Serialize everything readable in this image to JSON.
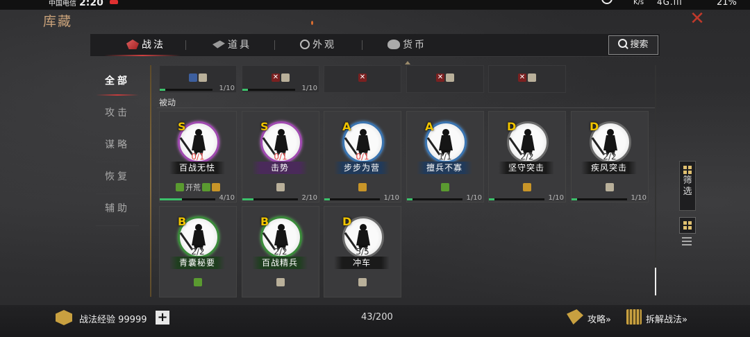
{
  "status_bar": {
    "carrier": "中国电信",
    "time": "2:20",
    "net_speed": "K/s",
    "signal": "4G.ıll",
    "battery": "21%"
  },
  "page_title": "库藏",
  "tabs": [
    {
      "label": "战法",
      "icon": "scroll-icon",
      "active": true
    },
    {
      "label": "道具",
      "icon": "item-icon",
      "active": false
    },
    {
      "label": "外观",
      "icon": "refresh-icon",
      "active": false
    },
    {
      "label": "货币",
      "icon": "coin-bag-icon",
      "active": false
    }
  ],
  "search_label": "搜索",
  "left_nav": [
    "全部",
    "攻击",
    "谋略",
    "恢复",
    "辅助"
  ],
  "top_cards": [
    {
      "tags": [
        "blue",
        "bag"
      ],
      "progress": 0.1,
      "count": "1/10"
    },
    {
      "tags": [
        "x",
        "bag"
      ],
      "progress": 0.1,
      "count": "1/10"
    },
    {
      "tags": [
        "x"
      ],
      "progress": null,
      "count": ""
    },
    {
      "tags": [
        "x",
        "bag"
      ],
      "progress": null,
      "count": ""
    },
    {
      "tags": [
        "x",
        "bag"
      ],
      "progress": null,
      "count": ""
    }
  ],
  "section_label": "被动",
  "cards": [
    {
      "grade": "S",
      "rarity": "s",
      "fraction": "0/1",
      "frac_style": "red",
      "name": "百战无怯",
      "banner": "",
      "tags": [
        "green",
        "kaihuang",
        "green",
        "gold"
      ],
      "kaihuang_text": "开荒",
      "progress": 0.4,
      "count": "4/10"
    },
    {
      "grade": "S",
      "rarity": "s",
      "fraction": "0/1",
      "frac_style": "red",
      "name": "击势",
      "banner": "purple",
      "tags": [
        "bag"
      ],
      "kaihuang_text": "",
      "progress": 0.2,
      "count": "2/10"
    },
    {
      "grade": "A",
      "rarity": "a",
      "fraction": "0/1",
      "frac_style": "red",
      "name": "步步为营",
      "banner": "blue",
      "tags": [
        "gold"
      ],
      "kaihuang_text": "",
      "progress": 0.1,
      "count": "1/10"
    },
    {
      "grade": "A",
      "rarity": "a",
      "fraction": "1/1",
      "frac_style": "dark",
      "name": "擅兵不寡",
      "banner": "blue",
      "tags": [
        "green"
      ],
      "kaihuang_text": "",
      "progress": 0.1,
      "count": "1/10"
    },
    {
      "grade": "D",
      "rarity": "d",
      "fraction": "2/2",
      "frac_style": "dark",
      "name": "坚守突击",
      "banner": "",
      "tags": [
        "gold"
      ],
      "kaihuang_text": "",
      "progress": 0.1,
      "count": "1/10"
    },
    {
      "grade": "D",
      "rarity": "d",
      "fraction": "2/2",
      "frac_style": "dark",
      "name": "疾风突击",
      "banner": "",
      "tags": [
        "bag"
      ],
      "kaihuang_text": "",
      "progress": 0.1,
      "count": "1/10"
    },
    {
      "grade": "B",
      "rarity": "b",
      "fraction": "2/2",
      "frac_style": "dark",
      "name": "青囊秘要",
      "banner": "green",
      "tags": [
        "green"
      ],
      "kaihuang_text": "",
      "progress": null,
      "count": ""
    },
    {
      "grade": "B",
      "rarity": "b",
      "fraction": "2/2",
      "frac_style": "dark",
      "name": "百战精兵",
      "banner": "green",
      "tags": [
        "bag"
      ],
      "kaihuang_text": "",
      "progress": null,
      "count": ""
    },
    {
      "grade": "D",
      "rarity": "d",
      "fraction": "5/5",
      "frac_style": "dark",
      "name": "冲车",
      "banner": "",
      "tags": [
        "bag"
      ],
      "kaihuang_text": "",
      "progress": null,
      "count": ""
    }
  ],
  "filter_label": "筛选",
  "bottom": {
    "exp_label": "战法经验 99999",
    "plus": "+",
    "capacity": "43/200",
    "guide": "攻略»",
    "dismantle": "拆解战法»"
  },
  "colors": {
    "accent": "#d04040",
    "progress": "#3cc06a",
    "grade": "#f0c400",
    "gold": "#c8a040"
  }
}
